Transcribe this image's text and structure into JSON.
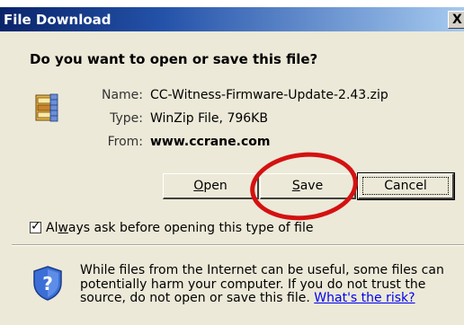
{
  "dialog": {
    "title": "File Download",
    "close_glyph": "X"
  },
  "question": "Do you want to open or save this file?",
  "file": {
    "icon": "winzip-file-icon",
    "name_label": "Name:",
    "name_value": "CC-Witness-Firmware-Update-2.43.zip",
    "type_label": "Type:",
    "type_value": "WinZip File, 796KB",
    "from_label": "From:",
    "from_value": "www.ccrane.com"
  },
  "buttons": {
    "open": {
      "mnemonic": "O",
      "rest": "pen"
    },
    "save": {
      "mnemonic": "S",
      "rest": "ave"
    },
    "cancel": "Cancel"
  },
  "checkbox": {
    "checked": true,
    "label_before": "Al",
    "mnemonic": "w",
    "label_after": "ays ask before opening this type of file"
  },
  "warning": {
    "icon": "shield-question-icon",
    "text": "While files from the Internet can be useful, some files can potentially harm your computer. If you do not trust the source, do not open or save this file.",
    "link": "What's the risk?"
  },
  "colors": {
    "titlebar": "#0a246a",
    "highlight": "#d41111",
    "dialog_bg": "#ece9d8"
  }
}
